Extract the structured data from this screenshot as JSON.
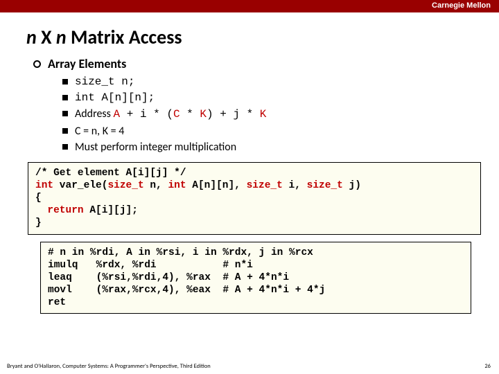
{
  "header": {
    "brand": "Carnegie Mellon"
  },
  "title": {
    "n1": "n",
    "x": " X ",
    "n2": "n",
    "rest": " Matrix Access"
  },
  "section": {
    "heading": "Array Elements"
  },
  "bullets": {
    "b1": "size_t n;",
    "b2": "int A[n][n];",
    "b3_pre": "Address ",
    "b3_A": "A",
    "b3_mid1": " + i * (",
    "b3_C": "C",
    "b3_mid2": " * ",
    "b3_K1": "K",
    "b3_mid3": ") +  j * ",
    "b3_K2": "K",
    "b4": "C = n, K = 4",
    "b5": "Must perform integer multiplication"
  },
  "code1": {
    "l1_a": "/* Get element A[i][j] */",
    "l2_a": "int",
    "l2_b": " var_ele(",
    "l2_c": "size_t",
    "l2_d": " n, ",
    "l2_e": "int",
    "l2_f": " A[n][n], ",
    "l2_g": "size_t",
    "l2_h": " i, ",
    "l2_i": "size_t",
    "l2_j": " j)",
    "l3": "{",
    "l4_a": "  ",
    "l4_b": "return",
    "l4_c": " A[i][j];",
    "l5": "}"
  },
  "code2": {
    "l1": "# n in %rdi, A in %rsi, i in %rdx, j in %rcx",
    "l2": "imulq   %rdx, %rdi           # n*i",
    "l3": "leaq    (%rsi,%rdi,4), %rax  # A + 4*n*i",
    "l4": "movl    (%rax,%rcx,4), %eax  # A + 4*n*i + 4*j",
    "l5": "ret"
  },
  "footer": {
    "left": "Bryant and O'Hallaron, Computer Systems: A Programmer's Perspective, Third Edition",
    "page": "26"
  }
}
